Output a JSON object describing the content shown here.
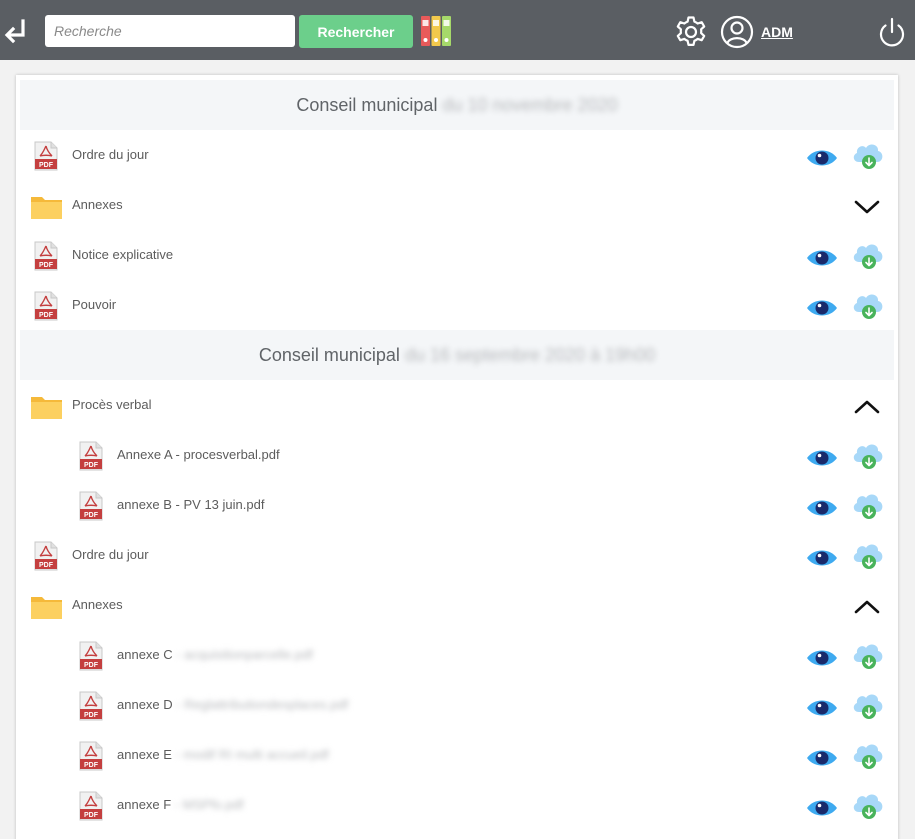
{
  "header": {
    "search_placeholder": "Recherche",
    "search_button": "Recherche",
    "search_button_label": "Rechercher",
    "user_label": "ADM",
    "accent_color": "#6ccf8b",
    "bar_color": "#5a5e63"
  },
  "sections": [
    {
      "title_prefix": "Conseil municipal",
      "title_blurred": "du 10 novembre 2020"
    },
    {
      "title_prefix": "Conseil municipal",
      "title_blurred": "du 16 septembre 2020 à 19h00"
    }
  ],
  "rows": [
    {
      "label": "Ordre du jour",
      "type": "pdf"
    },
    {
      "label": "Annexes",
      "type": "folder",
      "state": "collapsed"
    },
    {
      "label": "Notice explicative",
      "type": "pdf"
    },
    {
      "label": "Pouvoir",
      "type": "pdf"
    },
    {
      "label": "Procès verbal",
      "type": "folder",
      "state": "expanded"
    },
    {
      "label": "Annexe A - procesverbal.pdf",
      "type": "pdf"
    },
    {
      "label": "annexe B - PV 13 juin.pdf",
      "type": "pdf"
    },
    {
      "label": "Ordre du jour",
      "type": "pdf"
    },
    {
      "label": "Annexes",
      "type": "folder",
      "state": "expanded"
    },
    {
      "label": "annexe C",
      "label_blurred": "- acquisitionparcelle.pdf",
      "type": "pdf"
    },
    {
      "label": "annexe D",
      "label_blurred": "- Reglattributiondesplaces.pdf",
      "type": "pdf"
    },
    {
      "label": "annexe E",
      "label_blurred": "- modif RI multi accueil.pdf",
      "type": "pdf"
    },
    {
      "label": "annexe F",
      "label_blurred": "- MSPfo.pdf",
      "type": "pdf"
    }
  ]
}
